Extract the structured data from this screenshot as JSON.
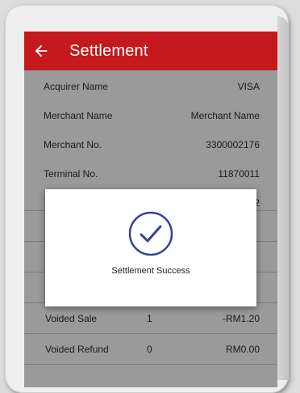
{
  "header": {
    "title": "Settlement"
  },
  "info": [
    {
      "label": "Acquirer Name",
      "value": "VISA"
    },
    {
      "label": "Merchant Name",
      "value": "Merchant Name"
    },
    {
      "label": "Merchant No.",
      "value": "3300002176"
    },
    {
      "label": "Terminal No.",
      "value": "11870011"
    },
    {
      "label": "",
      "value": "2"
    }
  ],
  "table": [
    {
      "name": "",
      "count": "",
      "amount": ""
    },
    {
      "name": "",
      "count": "",
      "amount": ""
    },
    {
      "name": "",
      "count": "",
      "amount": ""
    },
    {
      "name": "Voided Sale",
      "count": "1",
      "amount": "-RM1.20"
    },
    {
      "name": "Voided Refund",
      "count": "0",
      "amount": "RM0.00"
    }
  ],
  "dialog": {
    "message": "Settlement Success"
  },
  "colors": {
    "accent": "#c41a1e",
    "success_icon": "#3b3f91"
  }
}
